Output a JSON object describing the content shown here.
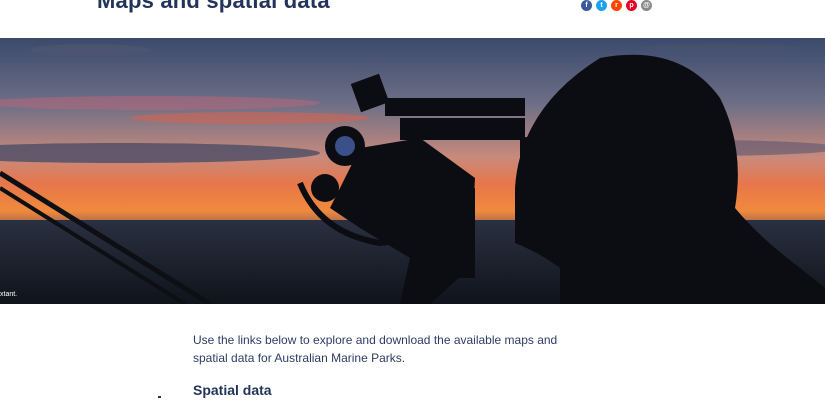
{
  "header": {
    "title": "Maps and spatial data"
  },
  "share": {
    "buttons": [
      {
        "icon": "facebook-icon",
        "glyph": "f",
        "color": "#3b5998"
      },
      {
        "icon": "twitter-icon",
        "glyph": "t",
        "color": "#1da1f2"
      },
      {
        "icon": "reddit-icon",
        "glyph": "r",
        "color": "#ff4500"
      },
      {
        "icon": "pinterest-icon",
        "glyph": "p",
        "color": "#e60023"
      },
      {
        "icon": "email-icon",
        "glyph": "@",
        "color": "#8a8a8a"
      }
    ]
  },
  "hero": {
    "caption": "xtant."
  },
  "main": {
    "intro": "Use the links below to explore and download the available maps and spatial data for Australian Marine Parks.",
    "section_heading": "Spatial data"
  },
  "colors": {
    "heading": "#23345a",
    "body_text": "#2e3d66"
  }
}
